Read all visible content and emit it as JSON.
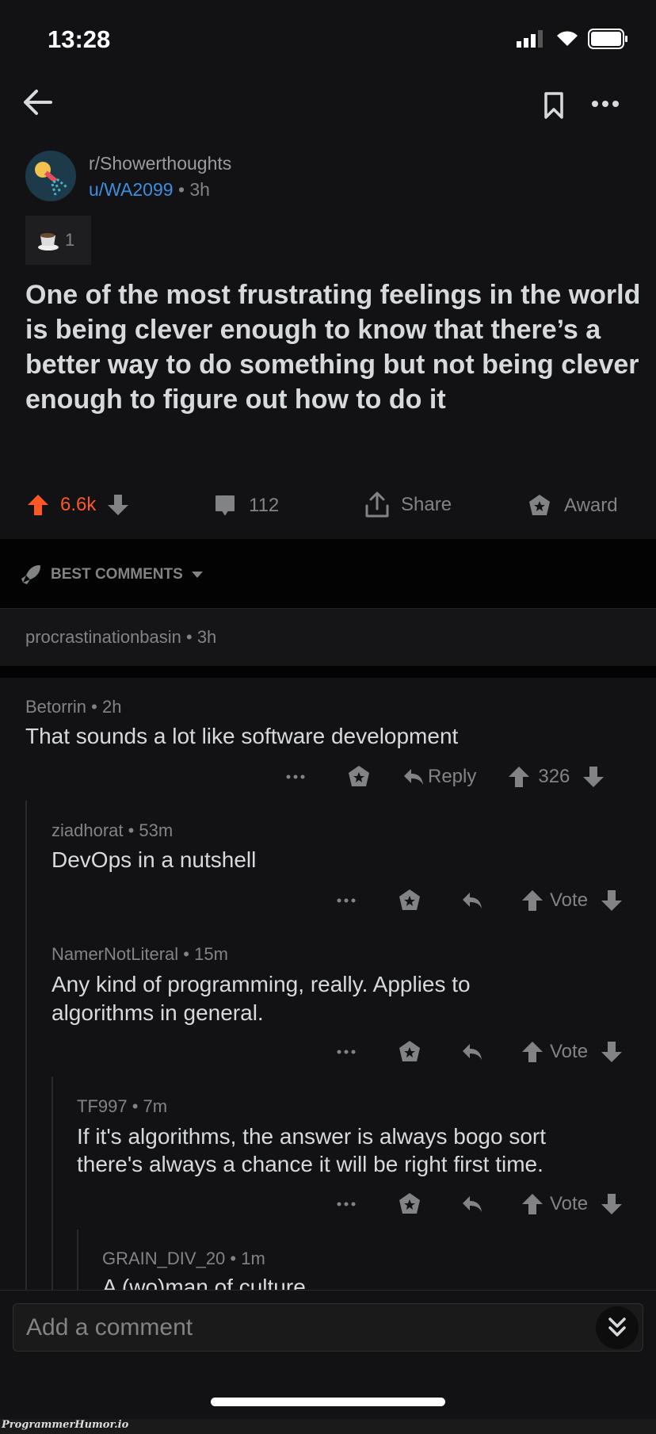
{
  "status_bar": {
    "time": "13:28"
  },
  "post": {
    "subreddit": "r/Showerthoughts",
    "author": "u/WA2099",
    "age": "• 3h",
    "award_count": "1",
    "title": "One of the most frustrating feelings in the world is being clever enough to know that there’s a better way to do something but not being clever enough to figure out how to do it",
    "score": "6.6k",
    "comments": "112",
    "share_label": "Share",
    "award_label": "Award"
  },
  "sort": {
    "label": "BEST COMMENTS"
  },
  "collapsed": {
    "meta": "procrastinationbasin • 3h"
  },
  "comments": [
    {
      "meta": "Betorrin • 2h",
      "lines": [
        "That sounds a lot like software development"
      ],
      "reply": "Reply",
      "score": "326"
    },
    {
      "meta": "ziadhorat • 53m",
      "lines": [
        "DevOps in a nutshell"
      ],
      "score": "Vote"
    },
    {
      "meta": "NamerNotLiteral • 15m",
      "lines": [
        "Any kind of programming, really. Applies to",
        "algorithms in general."
      ],
      "score": "Vote"
    },
    {
      "meta": "TF997 • 7m",
      "lines": [
        "If it's algorithms, the answer is always bogo sort",
        "there's always a chance it will be right first time."
      ],
      "score": "Vote"
    },
    {
      "meta": "GRAIN_DIV_20 • 1m",
      "lines": [
        "A (wo)man of culture"
      ]
    }
  ],
  "composer": {
    "placeholder": "Add a comment"
  },
  "watermark": "ProgrammerHumor.io",
  "colors": {
    "upvote": "#ff5722",
    "username": "#3d8ee0",
    "background": "#121214"
  }
}
